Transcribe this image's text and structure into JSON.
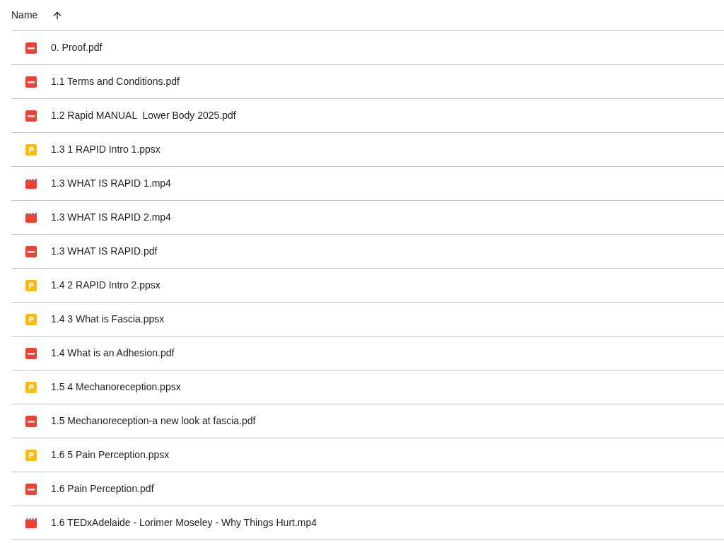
{
  "header": {
    "name_label": "Name",
    "sort_ascending": true
  },
  "files": [
    {
      "kind": "pdf",
      "name": "0. Proof.pdf"
    },
    {
      "kind": "pdf",
      "name": "1.1 Terms and Conditions.pdf"
    },
    {
      "kind": "pdf",
      "name": "1.2 Rapid MANUAL  Lower Body 2025.pdf"
    },
    {
      "kind": "slides",
      "name": "1.3 1 RAPID Intro 1.ppsx"
    },
    {
      "kind": "video",
      "name": "1.3 WHAT IS RAPID 1.mp4"
    },
    {
      "kind": "video",
      "name": "1.3 WHAT IS RAPID 2.mp4"
    },
    {
      "kind": "pdf",
      "name": "1.3 WHAT IS RAPID.pdf"
    },
    {
      "kind": "slides",
      "name": "1.4 2 RAPID Intro 2.ppsx"
    },
    {
      "kind": "slides",
      "name": "1.4 3 What is Fascia.ppsx"
    },
    {
      "kind": "pdf",
      "name": "1.4 What is an Adhesion.pdf"
    },
    {
      "kind": "slides",
      "name": "1.5 4 Mechanoreception.ppsx"
    },
    {
      "kind": "pdf",
      "name": "1.5 Mechanoreception-a new look at fascia.pdf"
    },
    {
      "kind": "slides",
      "name": "1.6 5 Pain Perception.ppsx"
    },
    {
      "kind": "pdf",
      "name": "1.6 Pain Perception.pdf"
    },
    {
      "kind": "video",
      "name": "1.6 TEDxAdelaide - Lorimer Moseley - Why Things Hurt.mp4"
    }
  ]
}
